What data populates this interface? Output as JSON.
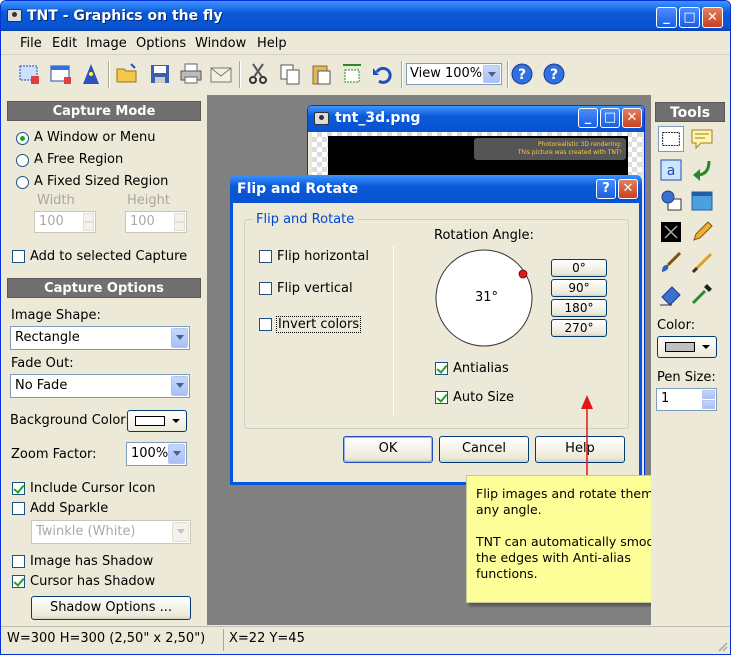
{
  "window": {
    "title": "TNT - Graphics on the fly",
    "minimize": "_",
    "maximize": "□",
    "close": "✕"
  },
  "menu": [
    "File",
    "Edit",
    "Image",
    "Options",
    "Window",
    "Help"
  ],
  "toolbar": {
    "zoom_value": "View 100%"
  },
  "capture_mode": {
    "header": "Capture Mode",
    "options": [
      "A Window or Menu",
      "A Free Region",
      "A Fixed Sized Region"
    ],
    "selected": 0,
    "width_label": "Width",
    "height_label": "Height",
    "width_value": "100",
    "height_value": "100",
    "add_to_selected": "Add to selected Capture"
  },
  "capture_options": {
    "header": "Capture Options",
    "image_shape_label": "Image Shape:",
    "image_shape_value": "Rectangle",
    "fade_out_label": "Fade Out:",
    "fade_out_value": "No Fade",
    "bg_color_label": "Background Color:",
    "bg_color": "#ffffff",
    "zoom_label": "Zoom Factor:",
    "zoom_value": "100%",
    "include_cursor": "Include Cursor Icon",
    "add_sparkle": "Add Sparkle",
    "sparkle_value": "Twinkle (White)",
    "image_shadow": "Image has Shadow",
    "cursor_shadow": "Cursor has Shadow",
    "shadow_options": "Shadow Options ..."
  },
  "tools": {
    "header": "Tools",
    "color_label": "Color:",
    "color_value": "#c0c0c0",
    "pen_size_label": "Pen Size:",
    "pen_size_value": "1"
  },
  "image_window": {
    "title": "tnt_3d.png",
    "caption_line1": "Photorealistic 3D rendering:",
    "caption_line2": "This picture was created with TNT!"
  },
  "dialog": {
    "title": "Flip and Rotate",
    "help_glyph": "?",
    "close_glyph": "✕",
    "group_label": "Flip and Rotate",
    "flip_horizontal": "Flip horizontal",
    "flip_vertical": "Flip vertical",
    "invert_colors": "Invert colors",
    "rotation_label": "Rotation Angle:",
    "angle_value": "31°",
    "angle_buttons": [
      "0°",
      "90°",
      "180°",
      "270°"
    ],
    "antialias": "Antialias",
    "auto_size": "Auto Size",
    "ok": "OK",
    "cancel": "Cancel",
    "help": "Help"
  },
  "callout": {
    "text1": "Flip images and rotate them at any angle.",
    "text2": "TNT can automatically smooth the edges with Anti-alias functions."
  },
  "statusbar": {
    "size": "W=300  H=300  (2,50\" x 2,50\")",
    "coords": "X=22  Y=45"
  }
}
